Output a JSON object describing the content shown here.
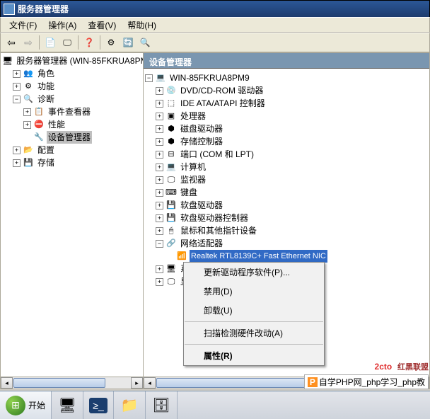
{
  "title": "服务器管理器",
  "menu": {
    "file": "文件(F)",
    "action": "操作(A)",
    "view": "查看(V)",
    "help": "帮助(H)"
  },
  "left": {
    "root": "服务器管理器 (WIN-85FKRUA8PM",
    "roles": "角色",
    "features": "功能",
    "diag": "诊断",
    "event": "事件查看器",
    "perf": "性能",
    "devmgr": "设备管理器",
    "config": "配置",
    "storage": "存储"
  },
  "right": {
    "header": "设备管理器",
    "root": "WIN-85FKRUA8PM9",
    "items": [
      "DVD/CD-ROM 驱动器",
      "IDE ATA/ATAPI 控制器",
      "处理器",
      "磁盘驱动器",
      "存储控制器",
      "端口 (COM 和 LPT)",
      "计算机",
      "监视器",
      "键盘",
      "软盘驱动器",
      "软盘驱动器控制器",
      "鼠标和其他指针设备",
      "网络适配器"
    ],
    "netadapter_selected": "Realtek RTL8139C+ Fast Ethernet NIC",
    "sysdev": "系统",
    "display": "显示"
  },
  "ctx": {
    "update": "更新驱动程序软件(P)...",
    "disable": "禁用(D)",
    "uninstall": "卸载(U)",
    "scan": "扫描检测硬件改动(A)",
    "props": "属性(R)"
  },
  "taskbar": {
    "start": "开始"
  },
  "wm": {
    "top": "2cto",
    "top2": "红黑联盟",
    "bot": "自学PHP网_php学习_php教"
  }
}
